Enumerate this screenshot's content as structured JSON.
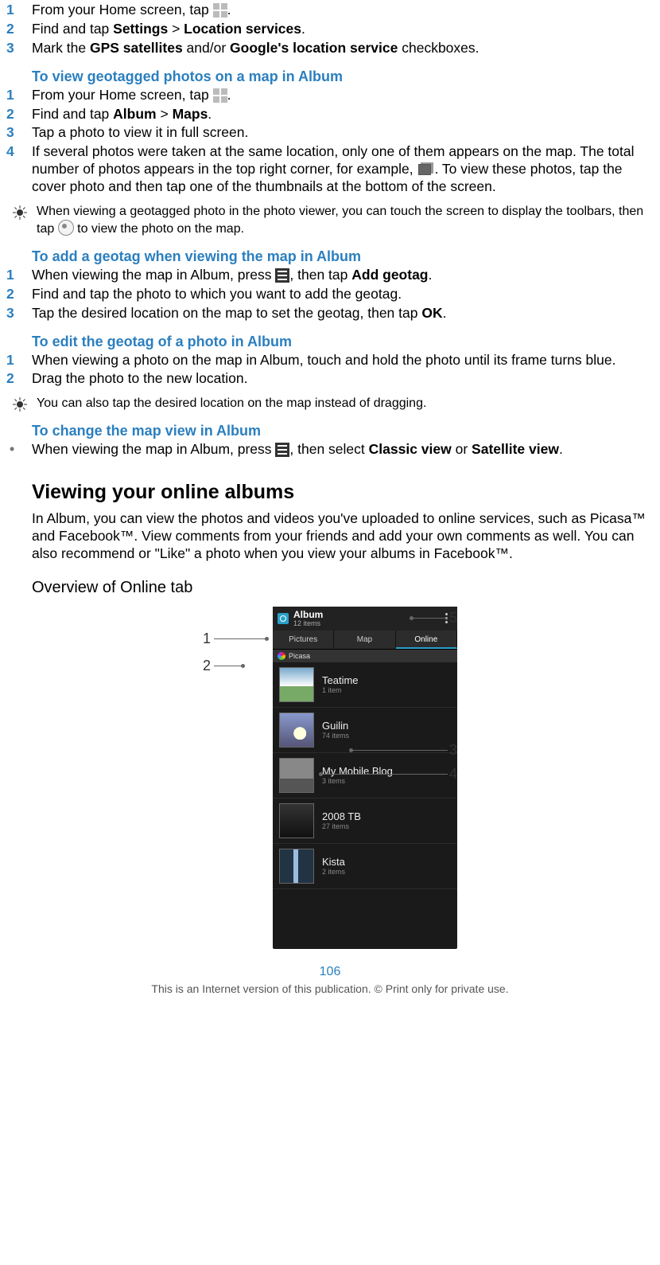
{
  "steps_enable_gps": [
    {
      "pre": "From your Home screen, tap ",
      "post": ".",
      "icon": "grid"
    },
    {
      "pre": "Find and tap ",
      "bold1": "Settings",
      "mid": " > ",
      "bold2": "Location services",
      "post": "."
    },
    {
      "pre": "Mark the ",
      "bold1": "GPS satellites",
      "mid": " and/or ",
      "bold2": "Google's location service",
      "post": " checkboxes."
    }
  ],
  "heading_view_geotagged": "To view geotagged photos on a map in Album",
  "steps_view_geotagged": [
    {
      "pre": "From your Home screen, tap ",
      "post": ".",
      "icon": "grid"
    },
    {
      "pre": "Find and tap ",
      "bold1": "Album",
      "mid": " > ",
      "bold2": "Maps",
      "post": "."
    },
    {
      "text": "Tap a photo to view it in full screen."
    },
    {
      "pre": "If several photos were taken at the same location, only one of them appears on the map. The total number of photos appears in the top right corner, for example, ",
      "icon": "stack",
      "post": ". To view these photos, tap the cover photo and then tap one of the thumbnails at the bottom of the screen."
    }
  ],
  "tip1": {
    "pre": "When viewing a geotagged photo in the photo viewer, you can touch the screen to display the toolbars, then tap ",
    "icon": "globe",
    "post": " to view the photo on the map."
  },
  "heading_add_geotag": "To add a geotag when viewing the map in Album",
  "steps_add_geotag": [
    {
      "pre": "When viewing the map in Album, press ",
      "icon": "menu",
      "mid": ", then tap ",
      "bold": "Add geotag",
      "post": "."
    },
    {
      "text": "Find and tap the photo to which you want to add the geotag."
    },
    {
      "pre": "Tap the desired location on the map to set the geotag, then tap ",
      "bold": "OK",
      "post": "."
    }
  ],
  "heading_edit_geotag": "To edit the geotag of a photo in Album",
  "steps_edit_geotag": [
    {
      "text": "When viewing a photo on the map in Album, touch and hold the photo until its frame turns blue."
    },
    {
      "text": "Drag the photo to the new location."
    }
  ],
  "tip2": "You can also tap the desired location on the map instead of dragging.",
  "heading_change_view": "To change the map view in Album",
  "bullet_change_view": {
    "pre": "When viewing the map in Album, press ",
    "icon": "menu",
    "mid": ", then select ",
    "bold1": "Classic view",
    "mid2": " or ",
    "bold2": "Satellite view",
    "post": "."
  },
  "h2_viewing": "Viewing your online albums",
  "para_viewing": "In Album, you can view the photos and videos you've uploaded to online services, such as Picasa™ and Facebook™. View comments from your friends and add your own comments as well. You can also recommend or \"Like\" a photo when you view your albums in Facebook™.",
  "h3_overview": "Overview of Online tab",
  "phone": {
    "title": "Album",
    "count": "12 items",
    "tabs": [
      "Pictures",
      "Map",
      "Online"
    ],
    "active_tab_index": 2,
    "section": "Picasa",
    "items": [
      {
        "name": "Teatime",
        "sub": "1 item"
      },
      {
        "name": "Guilin",
        "sub": "74 items"
      },
      {
        "name": "My Mobile Blog",
        "sub": "3 items"
      },
      {
        "name": "2008 TB",
        "sub": "27 items"
      },
      {
        "name": "Kista",
        "sub": "2 items"
      }
    ]
  },
  "callouts": [
    "1",
    "2",
    "3",
    "4",
    "5"
  ],
  "page_number": "106",
  "footer": "This is an Internet version of this publication. © Print only for private use."
}
